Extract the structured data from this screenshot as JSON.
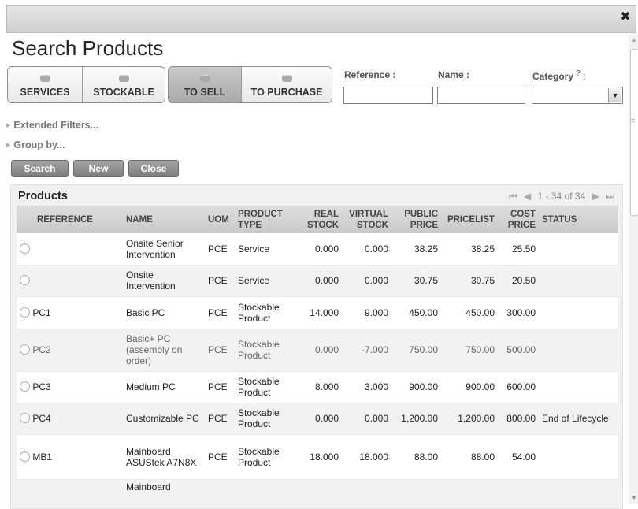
{
  "window": {
    "close_glyph": "✖"
  },
  "page_title": "Search Products",
  "filters": {
    "group1": [
      {
        "label": "SERVICES",
        "icon": "filter-icon"
      },
      {
        "label": "STOCKABLE",
        "icon": "filter-icon"
      }
    ],
    "group2": [
      {
        "label": "TO SELL",
        "icon": "filter-icon",
        "active": true
      },
      {
        "label": "TO PURCHASE",
        "icon": "filter-icon",
        "active": false
      }
    ],
    "reference_label": "Reference :",
    "reference_value": "",
    "name_label": "Name :",
    "name_value": "",
    "category_label": "Category",
    "category_help": "?",
    "category_suffix": " :",
    "category_value": ""
  },
  "extended_filters": "Extended Filters...",
  "group_by": "Group by...",
  "actions": {
    "search": "Search",
    "new": "New",
    "close": "Close"
  },
  "products": {
    "title": "Products",
    "pager": "1 - 34 of 34",
    "columns": [
      "REFERENCE",
      "NAME",
      "UOM",
      "PRODUCT TYPE",
      "REAL STOCK",
      "VIRTUAL STOCK",
      "PUBLIC PRICE",
      "PRICELIST",
      "COST PRICE",
      "STATUS"
    ],
    "rows": [
      {
        "reference": "",
        "name": "Onsite Senior Intervention",
        "uom": "PCE",
        "type": "Service",
        "real": "0.000",
        "virtual": "0.000",
        "public": "38.25",
        "pricelist": "38.25",
        "cost": "25.50",
        "status": ""
      },
      {
        "reference": "",
        "name": "Onsite Intervention",
        "uom": "PCE",
        "type": "Service",
        "real": "0.000",
        "virtual": "0.000",
        "public": "30.75",
        "pricelist": "30.75",
        "cost": "20.50",
        "status": ""
      },
      {
        "reference": "PC1",
        "name": "Basic PC",
        "uom": "PCE",
        "type": "Stockable Product",
        "real": "14.000",
        "virtual": "9.000",
        "public": "450.00",
        "pricelist": "450.00",
        "cost": "300.00",
        "status": ""
      },
      {
        "reference": "PC2",
        "name": "Basic+ PC (assembly on order)",
        "uom": "PCE",
        "type": "Stockable Product",
        "real": "0.000",
        "virtual": "-7.000",
        "public": "750.00",
        "pricelist": "750.00",
        "cost": "500.00",
        "status": ""
      },
      {
        "reference": "PC3",
        "name": "Medium PC",
        "uom": "PCE",
        "type": "Stockable Product",
        "real": "8.000",
        "virtual": "3.000",
        "public": "900.00",
        "pricelist": "900.00",
        "cost": "600.00",
        "status": ""
      },
      {
        "reference": "PC4",
        "name": "Customizable PC",
        "uom": "PCE",
        "type": "Stockable Product",
        "real": "0.000",
        "virtual": "0.000",
        "public": "1,200.00",
        "pricelist": "1,200.00",
        "cost": "800.00",
        "status": "End of Lifecycle"
      },
      {
        "reference": "MB1",
        "name": "Mainboard ASUStek A7N8X",
        "uom": "PCE",
        "type": "Stockable Product",
        "real": "18.000",
        "virtual": "18.000",
        "public": "88.00",
        "pricelist": "88.00",
        "cost": "54.00",
        "status": ""
      },
      {
        "reference": "",
        "name": "Mainboard",
        "uom": "",
        "type": "",
        "real": "",
        "virtual": "",
        "public": "",
        "pricelist": "",
        "cost": "",
        "status": ""
      }
    ]
  }
}
